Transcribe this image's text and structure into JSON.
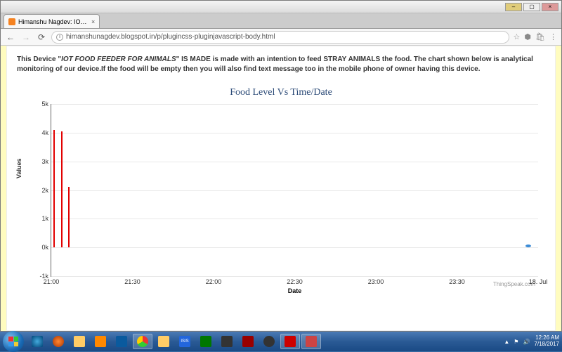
{
  "window": {
    "tab_title": "Himanshu Nagdev: IOT F",
    "url": "himanshunagdev.blogspot.in/p/plugincss-pluginjavascript-body.html"
  },
  "page": {
    "desc_pre": "This Device \"",
    "desc_device": "IOT FOOD FEEDER FOR ANIMALS",
    "desc_post": "\" IS MADE is made with an intention to feed STRAY ANIMALS the food. The chart shown below is analytical monitoring of our device.If the food will be empty then you will also find text message too in the mobile phone of owner having this device."
  },
  "chart_data": {
    "type": "line",
    "title": "Food Level Vs Time/Date",
    "xlabel": "Date",
    "ylabel": "Values",
    "ylim": [
      -1000,
      5000
    ],
    "yticks": [
      "-1k",
      "0k",
      "1k",
      "2k",
      "3k",
      "4k",
      "5k"
    ],
    "xticks": [
      "21:00",
      "21:30",
      "22:00",
      "22:30",
      "23:00",
      "23:30",
      "18. Jul"
    ],
    "series": [
      {
        "name": "red",
        "color": "#e20000",
        "points": [
          {
            "x": "20:58",
            "y": 0
          },
          {
            "x": "20:58",
            "y": 4100
          },
          {
            "x": "21:00",
            "y": 0
          },
          {
            "x": "21:00",
            "y": 4050
          },
          {
            "x": "21:02",
            "y": 0
          },
          {
            "x": "21:02",
            "y": 2100
          }
        ]
      },
      {
        "name": "blue",
        "color": "#3b8bd6",
        "points": [
          {
            "x": "18. Jul",
            "y": 50
          }
        ]
      }
    ],
    "credit": "ThingSpeak.com"
  },
  "taskbar": {
    "time": "12:26 AM",
    "date": "7/18/2017"
  },
  "icons": {
    "back": "←",
    "fwd": "→",
    "reload": "⟳",
    "star": "☆",
    "ext": "⬢",
    "cart": "🛒",
    "menu": "⋮",
    "close": "×"
  }
}
